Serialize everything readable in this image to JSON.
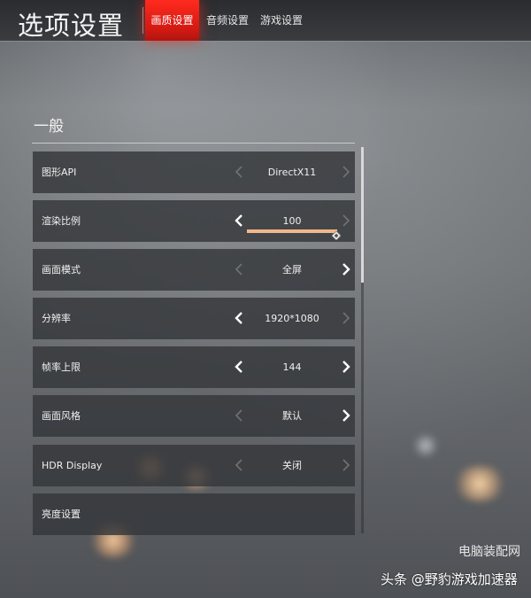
{
  "header": {
    "title": "选项设置",
    "tabs": [
      {
        "label": "画质设置",
        "active": true
      },
      {
        "label": "音频设置",
        "active": false
      },
      {
        "label": "游戏设置",
        "active": false
      }
    ]
  },
  "section": {
    "title": "一般"
  },
  "settings": [
    {
      "label": "图形API",
      "value": "DirectX11",
      "left_enabled": false,
      "right_enabled": false
    },
    {
      "label": "渲染比例",
      "value": "100",
      "left_enabled": true,
      "right_enabled": false,
      "slider_fraction": 1.0
    },
    {
      "label": "画面模式",
      "value": "全屏",
      "left_enabled": false,
      "right_enabled": true
    },
    {
      "label": "分辨率",
      "value": "1920*1080",
      "left_enabled": true,
      "right_enabled": false
    },
    {
      "label": "帧率上限",
      "value": "144",
      "left_enabled": true,
      "right_enabled": true
    },
    {
      "label": "画面风格",
      "value": "默认",
      "left_enabled": false,
      "right_enabled": true
    },
    {
      "label": "HDR Display",
      "value": "关闭",
      "left_enabled": false,
      "right_enabled": false
    },
    {
      "label": "亮度设置"
    }
  ],
  "colors": {
    "accent": "#e8241b",
    "slider": "#f0b88a"
  },
  "watermark": {
    "text": "头条 @野豹游戏加速器",
    "site": "电脑装配网"
  }
}
